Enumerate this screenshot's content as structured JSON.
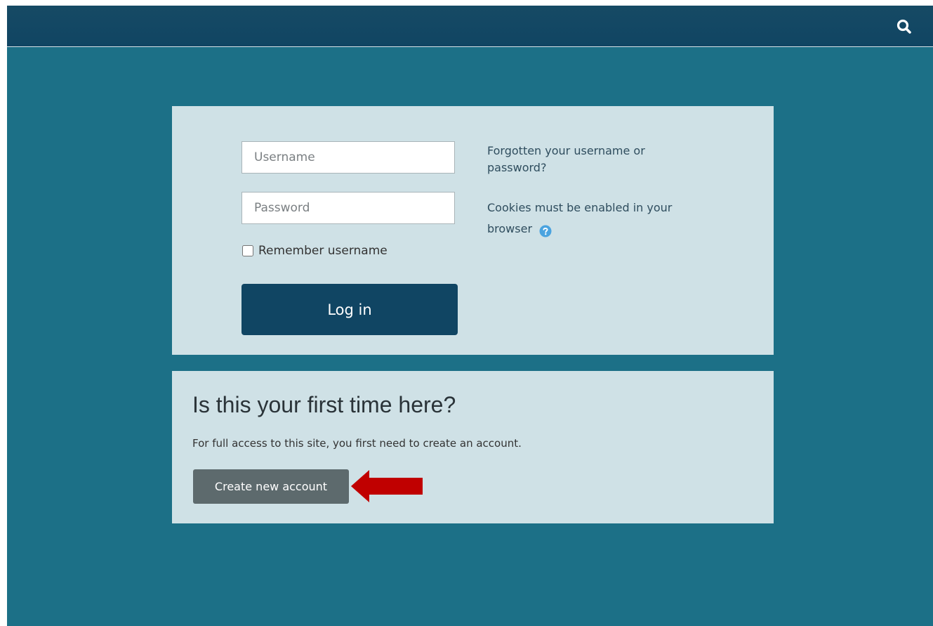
{
  "topbar": {
    "search_icon": "search-icon"
  },
  "login": {
    "username_placeholder": "Username",
    "password_placeholder": "Password",
    "remember_label": "Remember username",
    "login_label": "Log in",
    "forgot_link": "Forgotten your username or password?",
    "cookies_text": "Cookies must be enabled in your browser",
    "help_icon": "question-circle-icon"
  },
  "signup": {
    "heading": "Is this your first time here?",
    "description": "For full access to this site, you first need to create an account.",
    "create_label": "Create new account",
    "annotation_icon": "red-arrow-left-icon"
  },
  "colors": {
    "page_background": "#1c7087",
    "topbar": "#104563",
    "panel": "#cfe1e6",
    "primary_button": "#104563",
    "secondary_button": "#5d6a6d",
    "annotation_arrow": "#c00000",
    "help_icon": "#4aa3df"
  }
}
